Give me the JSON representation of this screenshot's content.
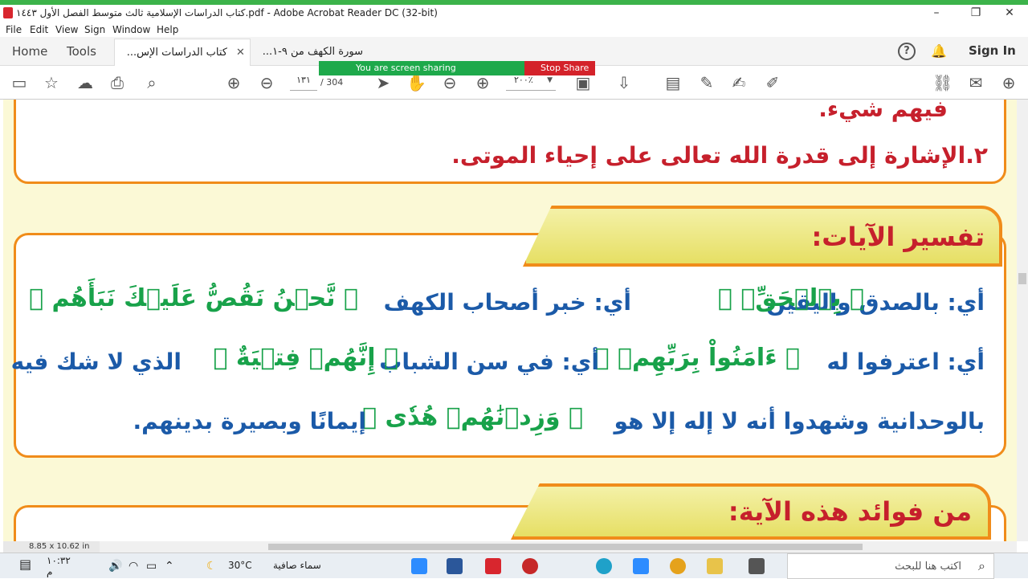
{
  "window": {
    "title": "كتاب الدراسات الإسلامية ثالث متوسط الفصل الأول ١٤٤٣.pdf - Adobe Acrobat Reader DC (32-bit)"
  },
  "menu": [
    "File",
    "Edit",
    "View",
    "Sign",
    "Window",
    "Help"
  ],
  "tabs": {
    "home": "Home",
    "tools": "Tools",
    "docs": [
      {
        "label": "كتاب الدراسات الإس...",
        "active": true
      },
      {
        "label": "سورة الكهف من ٩-١...",
        "active": false
      }
    ],
    "help": "?",
    "sign_in": "Sign In"
  },
  "toolbar": {
    "page_current": "١٣١",
    "page_total": "/ 304",
    "zoom": "٢٠٠٪"
  },
  "share": {
    "status": "You are screen sharing",
    "stop": "Stop Share"
  },
  "document": {
    "top_partial": "فيهم شيء.",
    "point_two": "٢.الإشارة إلى قدرة الله تعالى على إحياء الموتى.",
    "section1_title": "تفسير الآيات:",
    "section2_title": "من فوائد هذه الآية:",
    "line1": {
      "verse1": "﴿ نَّحۡنُ نَقُصُّ عَلَيۡكَ نَبَأَهُم ﴾",
      "text1": "أي: خبر أصحاب الكهف",
      "verse2": "﴿ بِٱلۡحَقِّۚ ﴾",
      "text2": "أي: بالصدق واليقين"
    },
    "line2": {
      "text0": "الذي لا شك فيه",
      "verse1": "﴿ إِنَّهُمۡ فِتۡيَةٌ ﴾",
      "text1": "أي: في سن الشباب",
      "verse2": "﴿ ءَامَنُواْ بِرَبِّهِمۡ ﴾",
      "text2": "أي: اعترفوا له"
    },
    "line3": {
      "text0": "بالوحدانية وشهدوا أنه لا إله إلا هو",
      "verse1": "﴿ وَزِدۡنَٰهُمۡ هُدٗى ﴾",
      "text1": "إيمانًا وبصيرة بدينهم."
    }
  },
  "status": {
    "page_size": "8.85 x 10.62 in"
  },
  "taskbar": {
    "search_placeholder": "اكتب هنا للبحث",
    "weather": "سماء صافية",
    "temperature": "30°C",
    "time": "١٠:٣٢",
    "ampm": "م"
  },
  "colors": {
    "accent_orange": "#f08c1a",
    "heading_red": "#c6202c",
    "body_blue": "#1b5aa8",
    "verse_green": "#18a24a",
    "page_bg": "#fbf9d6"
  }
}
